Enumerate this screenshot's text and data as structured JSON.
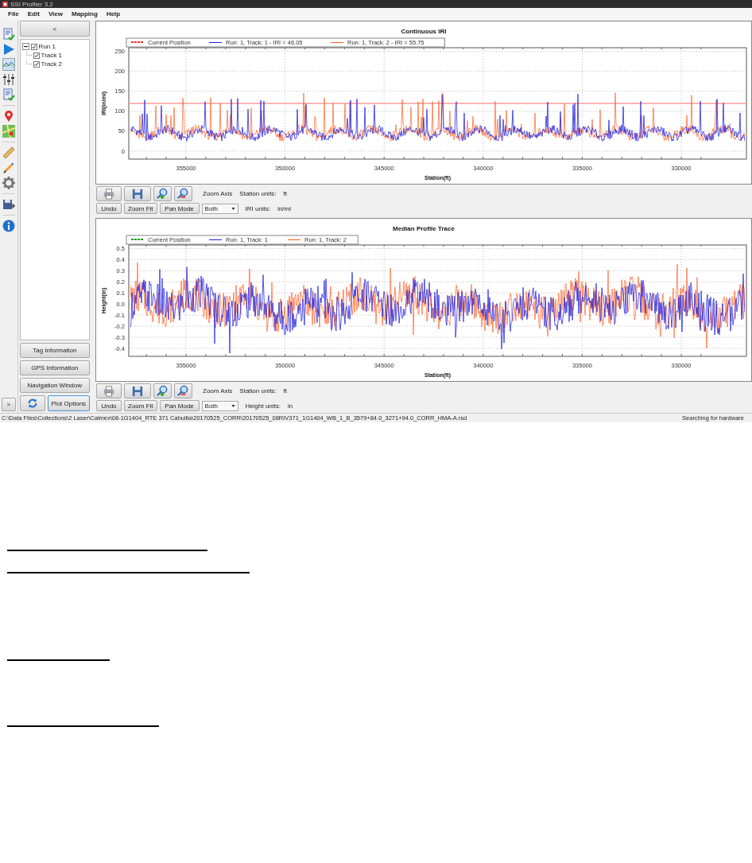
{
  "window": {
    "title": "SSI Profiler 3.2"
  },
  "menu": [
    "File",
    "Edit",
    "View",
    "Mapping",
    "Help"
  ],
  "sidebar": {
    "collapse_button": "<",
    "tree": [
      {
        "label": "Run 1",
        "checked": true,
        "expanded": true,
        "children": [
          {
            "label": "Track 1",
            "checked": true
          },
          {
            "label": "Track 2",
            "checked": true
          }
        ]
      }
    ],
    "buttons": [
      "Tag Information",
      "GPS Information",
      "Navigation Window"
    ],
    "expand_button": ">",
    "plot_options_button": "Plot Options"
  },
  "charts": [
    {
      "title": "Continuous IRI",
      "ylabel": "IRI(in/mi)",
      "xlabel": "Station(ft)",
      "threshold": true,
      "legend": [
        {
          "label": "Current Position",
          "kind": "dashed",
          "color": "#ff2a2a"
        },
        {
          "label": "Run: 1, Track: 1 - IRI = 46.05",
          "kind": "line",
          "color": "#1f1fe0"
        },
        {
          "label": "Run: 1, Track: 2 - IRI = 55.75",
          "kind": "line",
          "color": "#ff5a1f"
        }
      ],
      "yticks": [
        "250",
        "200",
        "150",
        "100",
        "50",
        "0"
      ],
      "xticks": [
        "355000",
        "350000",
        "345000",
        "340000",
        "335000",
        "330000"
      ],
      "toolbar": {
        "zoom_axis": "Zoom Axis",
        "station_units_label": "Station units:",
        "station_units": "ft",
        "buttons": [
          "Undo",
          "Zoom Fit",
          "Pan Mode"
        ],
        "axis_select": "Both",
        "units_label": "IRI units:",
        "units": "in/mi"
      }
    },
    {
      "title": "Median Profile Trace",
      "ylabel": "Height(in)",
      "xlabel": "Station(ft)",
      "threshold": false,
      "legend": [
        {
          "label": "Current Position",
          "kind": "dashed",
          "color": "#1a9a1a"
        },
        {
          "label": "Run: 1, Track: 1",
          "kind": "line",
          "color": "#1f1fe0"
        },
        {
          "label": "Run: 1, Track: 2",
          "kind": "line",
          "color": "#ff5a1f"
        }
      ],
      "yticks": [
        "0.5",
        "0.4",
        "0.3",
        "0.2",
        "0.1",
        "0.0",
        "-0.1",
        "-0.2",
        "-0.3",
        "-0.4"
      ],
      "xticks": [
        "355000",
        "350000",
        "345000",
        "340000",
        "335000",
        "330000"
      ],
      "toolbar": {
        "zoom_axis": "Zoom Axis",
        "station_units_label": "Station units:",
        "station_units": "ft",
        "buttons": [
          "Undo",
          "Zoom Fit",
          "Pan Mode"
        ],
        "axis_select": "Both",
        "units_label": "Height units:",
        "units": "in"
      }
    }
  ],
  "status_bar": {
    "path": "C:\\Data Files\\Collections\\2 Laser\\Calmex\\08-1G1404_RTE 371 Cahuilla\\20170525_CORR\\20170525_08RIV371_1G1404_WB_1_B_3579+84.0_3271+94.0_CORR_HMA-A.rsd",
    "status": "Searching for hardware"
  }
}
